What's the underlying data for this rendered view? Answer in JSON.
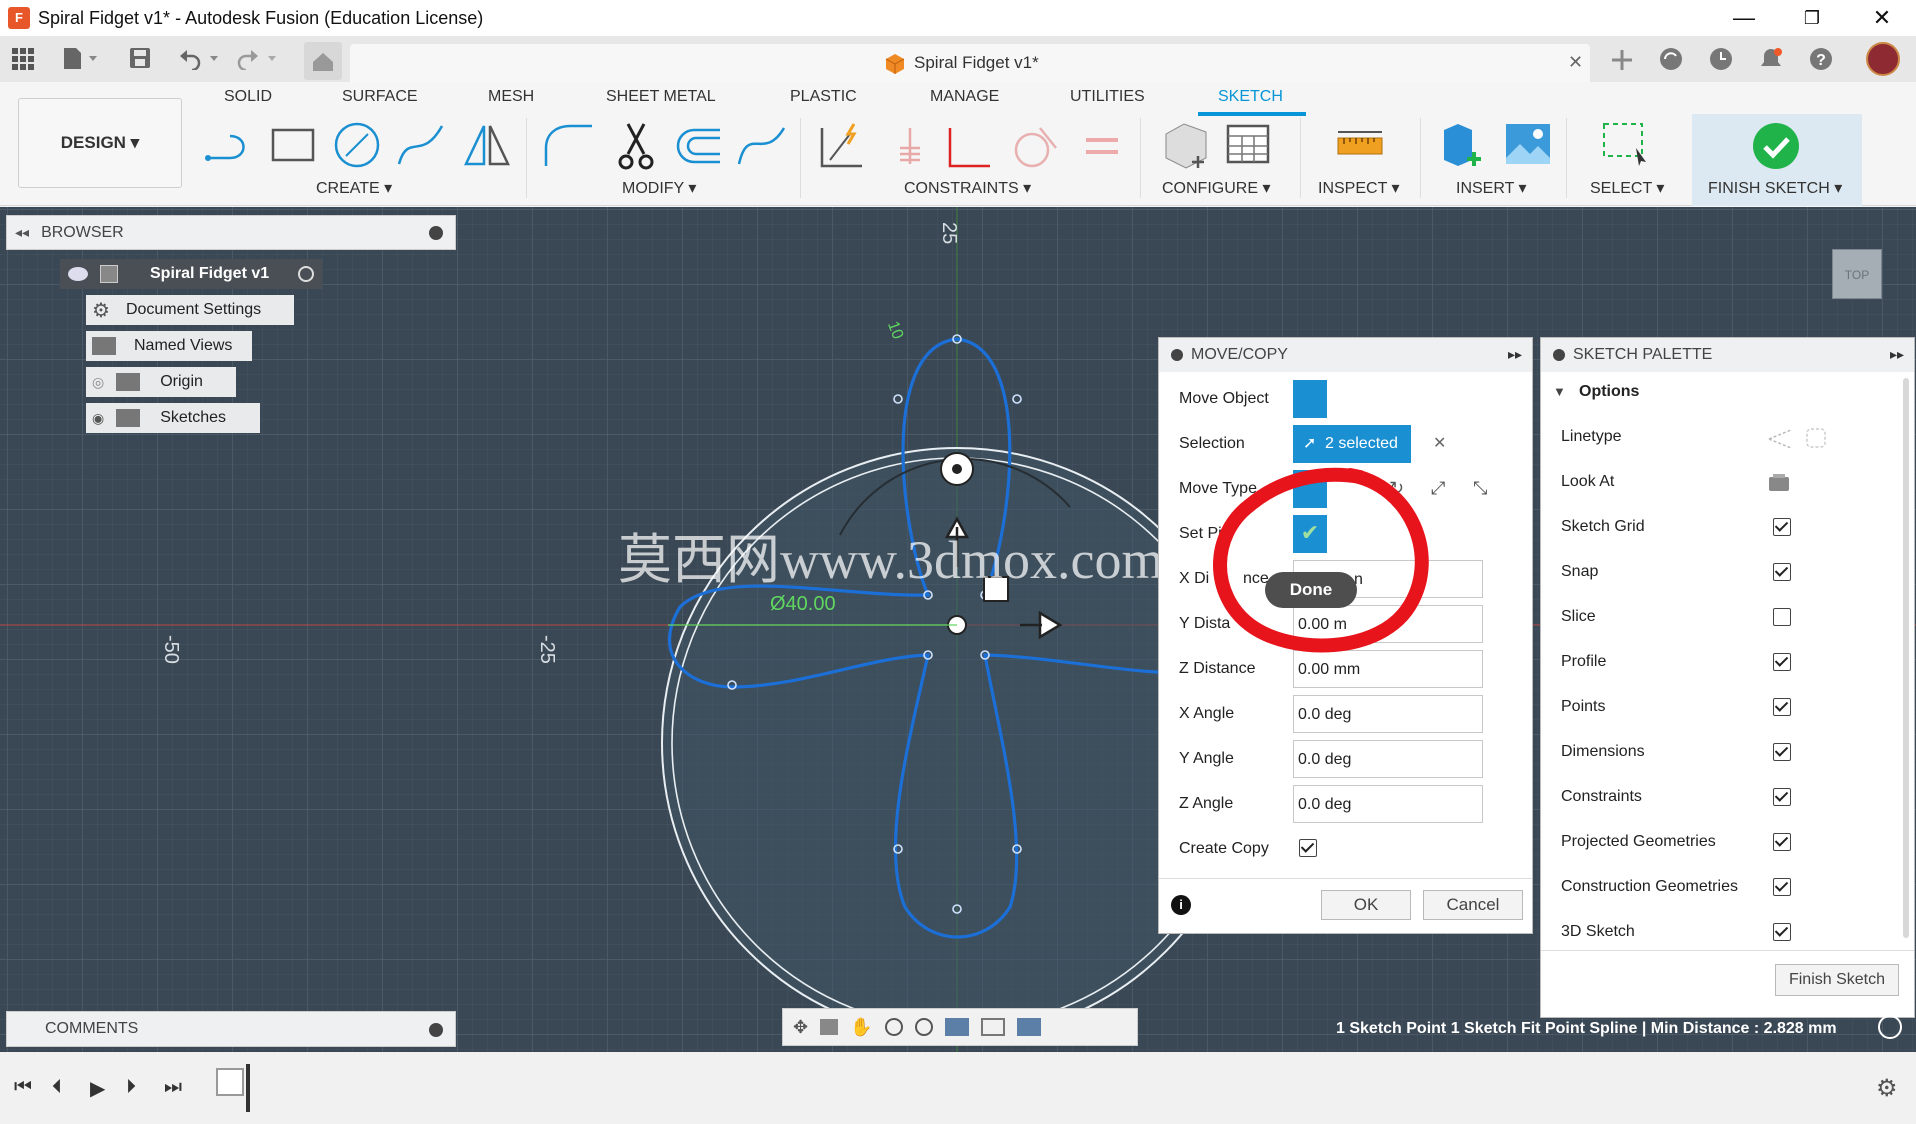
{
  "window": {
    "title": "Spiral Fidget v1* - Autodesk Fusion (Education License)",
    "app_icon_letter": "F",
    "minimize_glyph": "—",
    "maximize_glyph": "❐",
    "close_glyph": "✕"
  },
  "document_tab": {
    "title": "Spiral Fidget v1*",
    "close_glyph": "✕"
  },
  "workspace_button": {
    "label": "DESIGN ▾"
  },
  "ribbon": {
    "tabs": [
      "SOLID",
      "SURFACE",
      "MESH",
      "SHEET METAL",
      "PLASTIC",
      "MANAGE",
      "UTILITIES",
      "SKETCH"
    ],
    "active_tab": "SKETCH",
    "groups": {
      "create": "CREATE ▾",
      "modify": "MODIFY ▾",
      "constraints": "CONSTRAINTS ▾",
      "configure": "CONFIGURE ▾",
      "inspect": "INSPECT ▾",
      "insert": "INSERT ▾",
      "select": "SELECT ▾",
      "finish": "FINISH SKETCH ▾"
    },
    "accent_color": "#0696d7",
    "finish_color": "#1fb34a"
  },
  "browser": {
    "title": "BROWSER",
    "root": "Spiral Fidget v1",
    "items": [
      "Document Settings",
      "Named Views",
      "Origin",
      "Sketches"
    ]
  },
  "canvas": {
    "ruler_labels": {
      "top": "25",
      "left_far": "-50",
      "left_near": "-25"
    },
    "dimension_text": "Ø40.00",
    "small_dim": "10",
    "watermark": "莫西网www.3dmox.com",
    "viewcube_label": "TOP"
  },
  "move_copy": {
    "title": "MOVE/COPY",
    "expand_glyph": "▸▸",
    "move_object_label": "Move Object",
    "selection_label": "Selection",
    "selection_value": "2 selected",
    "clear_glyph": "✕",
    "move_type_label": "Move Type",
    "set_pivot_label": "Set Pi",
    "x_distance_label": "X Di",
    "x_distance_tail": "nce",
    "x_distance_value": "n",
    "y_distance_label": "Y Dista",
    "y_distance_value": "0.00 m",
    "z_distance_label": "Z Distance",
    "z_distance_value": "0.00 mm",
    "x_angle_label": "X Angle",
    "x_angle_value": "0.0 deg",
    "y_angle_label": "Y Angle",
    "y_angle_value": "0.0 deg",
    "z_angle_label": "Z Angle",
    "z_angle_value": "0.0 deg",
    "create_copy_label": "Create Copy",
    "create_copy_checked": true,
    "done_tooltip": "Done",
    "ok_label": "OK",
    "cancel_label": "Cancel"
  },
  "sketch_palette": {
    "title": "SKETCH PALETTE",
    "expand_glyph": "▸▸",
    "section": "Options",
    "linetype_label": "Linetype",
    "look_at_label": "Look At",
    "options": [
      {
        "label": "Sketch Grid",
        "checked": true
      },
      {
        "label": "Snap",
        "checked": true
      },
      {
        "label": "Slice",
        "checked": false
      },
      {
        "label": "Profile",
        "checked": true
      },
      {
        "label": "Points",
        "checked": true
      },
      {
        "label": "Dimensions",
        "checked": true
      },
      {
        "label": "Constraints",
        "checked": true
      },
      {
        "label": "Projected Geometries",
        "checked": true
      },
      {
        "label": "Construction Geometries",
        "checked": true
      },
      {
        "label": "3D Sketch",
        "checked": true
      }
    ],
    "finish_button": "Finish Sketch"
  },
  "comments": {
    "title": "COMMENTS"
  },
  "status_text": "1 Sketch Point 1 Sketch Fit Point Spline | Min Distance : 2.828 mm",
  "annotation_color": "#e8141c"
}
